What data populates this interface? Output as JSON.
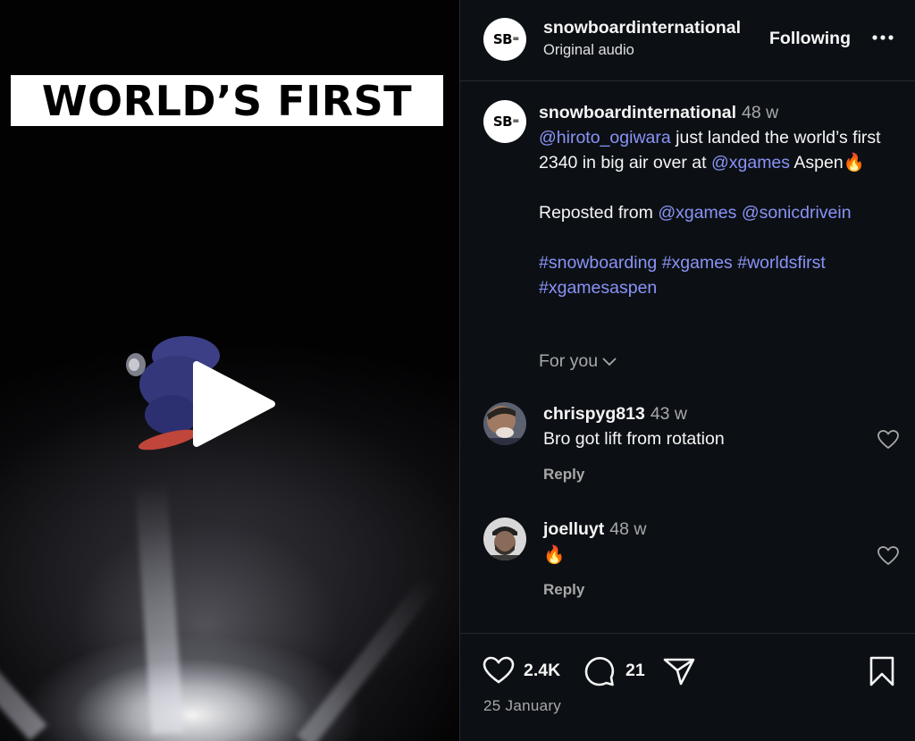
{
  "video": {
    "headline": "WORLD’S FIRST",
    "play_icon": "play-icon"
  },
  "header": {
    "avatar_text": "SB",
    "username": "snowboardinternational",
    "audio": "Original audio",
    "following": "Following",
    "more_icon": "more-horizontal-icon"
  },
  "caption": {
    "avatar_text": "SB",
    "username": "snowboardinternational",
    "time": "48 w",
    "mention1": "@hiroto_ogiwara",
    "text1": " just landed the world’s first 2340 in big air over at ",
    "mention2": "@xgames",
    "text2": " Aspen🔥",
    "reposted": "Reposted from ",
    "mention3": "@xgames",
    "mention4": "@sonicdrivein",
    "tags": [
      "#snowboarding",
      "#xgames",
      "#worldsfirst",
      "#xgamesaspen"
    ]
  },
  "for_you": "For you",
  "comments": [
    {
      "username": "chrispyg813",
      "time": "43 w",
      "text": "Bro got lift from rotation",
      "reply": "Reply"
    },
    {
      "username": "joelluyt",
      "time": "48 w",
      "text": "🔥",
      "reply": "Reply"
    }
  ],
  "actions": {
    "likes": "2.4K",
    "comments": "21",
    "date": "25 January"
  },
  "colors": {
    "link": "#8a93f7",
    "panel_bg": "#0c1014",
    "muted": "#a8a8a8"
  }
}
